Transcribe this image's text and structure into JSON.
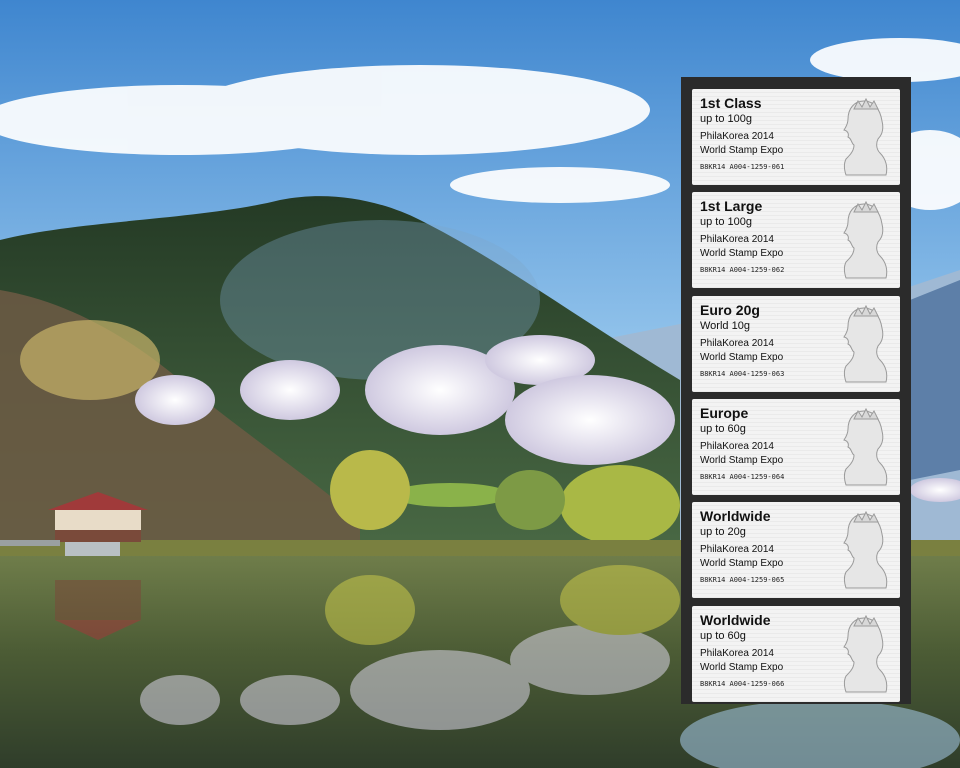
{
  "image": {
    "subject": "lake",
    "colors": {
      "sky": "#4f8fd0",
      "hill": "#2f4a2c",
      "blossom": "#e9e6f2",
      "water": "#4a5a3a",
      "pavilion_roof": "#a03a3a"
    }
  },
  "stamp_strip": {
    "stamps": [
      {
        "title": "1st Class",
        "weight": "up to 100g",
        "event_line1": "PhilaKorea 2014",
        "event_line2": "World Stamp Expo",
        "code": "B8KR14 A004-1259-061"
      },
      {
        "title": "1st Large",
        "weight": "up to 100g",
        "event_line1": "PhilaKorea 2014",
        "event_line2": "World Stamp Expo",
        "code": "B8KR14 A004-1259-062"
      },
      {
        "title": "Euro 20g",
        "weight": "World 10g",
        "event_line1": "PhilaKorea 2014",
        "event_line2": "World Stamp Expo",
        "code": "B8KR14 A004-1259-063"
      },
      {
        "title": "Europe",
        "weight": "up to 60g",
        "event_line1": "PhilaKorea 2014",
        "event_line2": "World Stamp Expo",
        "code": "B8KR14 A004-1259-064"
      },
      {
        "title": "Worldwide",
        "weight": "up to 20g",
        "event_line1": "PhilaKorea 2014",
        "event_line2": "World Stamp Expo",
        "code": "B8KR14 A004-1259-065"
      },
      {
        "title": "Worldwide",
        "weight": "up to 60g",
        "event_line1": "PhilaKorea 2014",
        "event_line2": "World Stamp Expo",
        "code": "B8KR14 A004-1259-066"
      }
    ]
  }
}
